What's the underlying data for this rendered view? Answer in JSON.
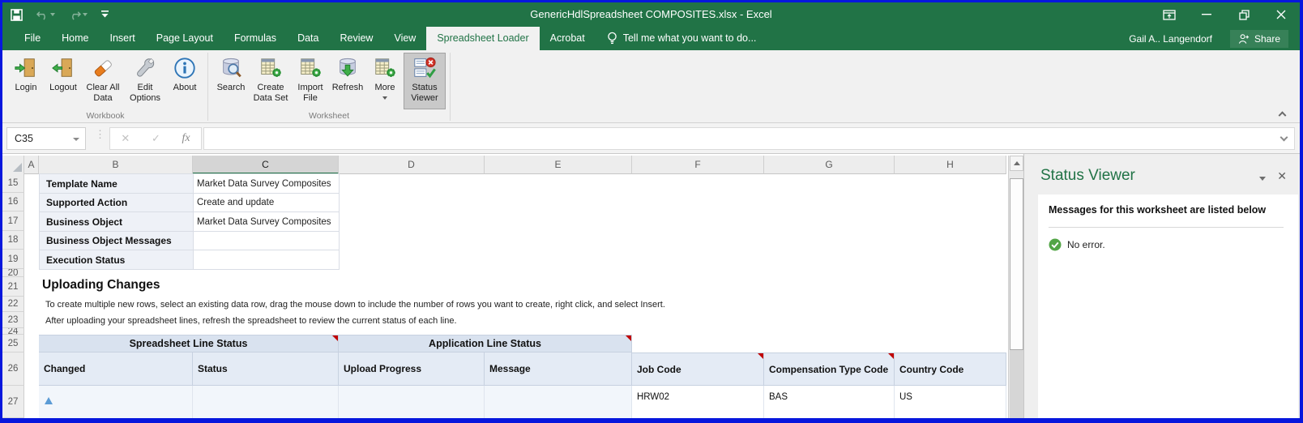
{
  "window": {
    "title": "GenericHdlSpreadsheet COMPOSITES.xlsx - Excel",
    "user": "Gail A.. Langendorf",
    "share": "Share"
  },
  "tabs": {
    "items": [
      "File",
      "Home",
      "Insert",
      "Page Layout",
      "Formulas",
      "Data",
      "Review",
      "View",
      "Spreadsheet Loader",
      "Acrobat"
    ],
    "active": "Spreadsheet Loader",
    "tell_me": "Tell me what you want to do..."
  },
  "ribbon": {
    "workbook": {
      "label": "Workbook",
      "buttons": [
        "Login",
        "Logout",
        "Clear All Data",
        "Edit Options",
        "About"
      ]
    },
    "worksheet": {
      "label": "Worksheet",
      "buttons": [
        "Search",
        "Create Data Set",
        "Import File",
        "Refresh",
        "More",
        "Status Viewer"
      ]
    }
  },
  "formula_bar": {
    "name_box": "C35",
    "fx_label": "fx"
  },
  "sheet": {
    "columns": [
      "A",
      "B",
      "C",
      "D",
      "E",
      "F",
      "G",
      "H"
    ],
    "selected_column": "C",
    "active_cell": "C35",
    "row_numbers": [
      "15",
      "16",
      "17",
      "18",
      "19",
      "20",
      "21",
      "22",
      "23",
      "24",
      "25",
      "26",
      "27"
    ],
    "info_table": [
      {
        "label": "Template Name",
        "value": "Market Data Survey Composites"
      },
      {
        "label": "Supported Action",
        "value": "Create and update"
      },
      {
        "label": "Business Object",
        "value": "Market Data Survey Composites"
      },
      {
        "label": "Business Object Messages",
        "value": ""
      },
      {
        "label": "Execution Status",
        "value": ""
      }
    ],
    "uploading": {
      "heading": "Uploading Changes",
      "line1": "To create multiple new rows, select an existing data row, drag the mouse down to include the number of rows you want to create, right click, and select Insert.",
      "line2": "After uploading your spreadsheet lines, refresh the spreadsheet to review the current status of each line."
    },
    "status_table": {
      "groups": [
        "Spreadsheet Line Status",
        "Application Line Status"
      ],
      "headers": [
        "Changed",
        "Status",
        "Upload Progress",
        "Message",
        "Job Code",
        "Compensation Type Code",
        "Country Code"
      ],
      "row": {
        "job_code": "HRW02",
        "compensation_type_code": "BAS",
        "country_code": "US"
      }
    }
  },
  "status_viewer": {
    "title": "Status Viewer",
    "subtitle": "Messages for this worksheet are listed below",
    "message": "No error."
  },
  "colors": {
    "excel_green": "#217346",
    "table_header_blue": "#d9e2ef",
    "table_header_blue_light": "#e4ebf5",
    "changed_marker_blue": "#5b9bd5",
    "comment_red": "#c00000",
    "ok_green": "#4ea72e",
    "error_red": "#d23227",
    "window_border_blue": "#0717dd"
  }
}
